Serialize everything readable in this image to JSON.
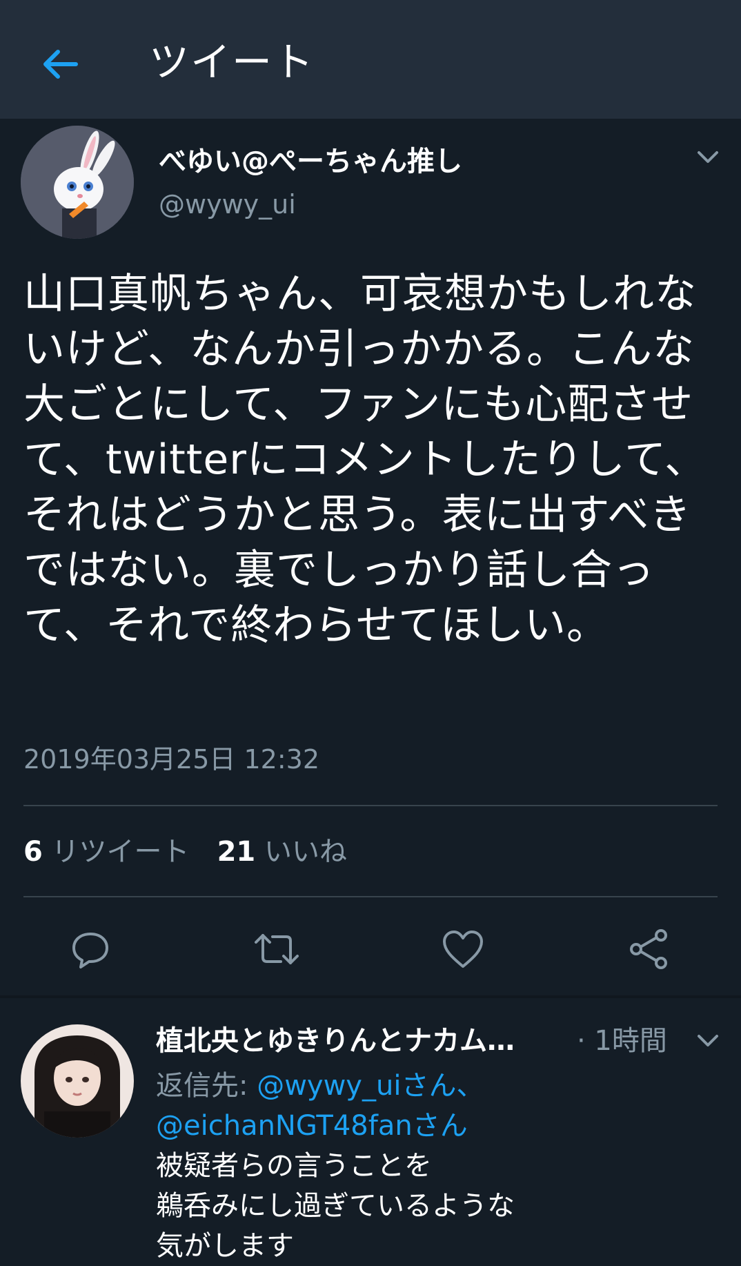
{
  "header": {
    "title": "ツイート",
    "back_icon": "arrow-left-icon",
    "accent_color": "#1da1f2"
  },
  "tweet": {
    "author_name": "べゆい@ぺーちゃん推し",
    "author_handle": "@wywy_ui",
    "text": "山口真帆ちゃん、可哀想かもしれないけど、なんか引っかかる。こんな大ごとにして、ファンにも心配させて、twitterにコメントしたりして、それはどうかと思う。表に出すべきではない。裏でしっかり話し合って、それで終わらせてほしい。",
    "timestamp": "2019年03月25日 12:32",
    "retweet_count": "6",
    "retweet_label": "リツイート",
    "like_count": "21",
    "like_label": "いいね"
  },
  "actions": {
    "icons": [
      "reply-icon",
      "retweet-icon",
      "like-icon",
      "share-icon"
    ]
  },
  "reply": {
    "author_name": "植北央とゆきりんとナカム…",
    "time": "· 1時間",
    "reply_to_label": "返信先:",
    "mention_1": "@wywy_uiさん、",
    "mention_2": "@eichanNGT48fanさん",
    "text": "被疑者らの言うことを\n鵜呑みにし過ぎているような\n気がします"
  }
}
